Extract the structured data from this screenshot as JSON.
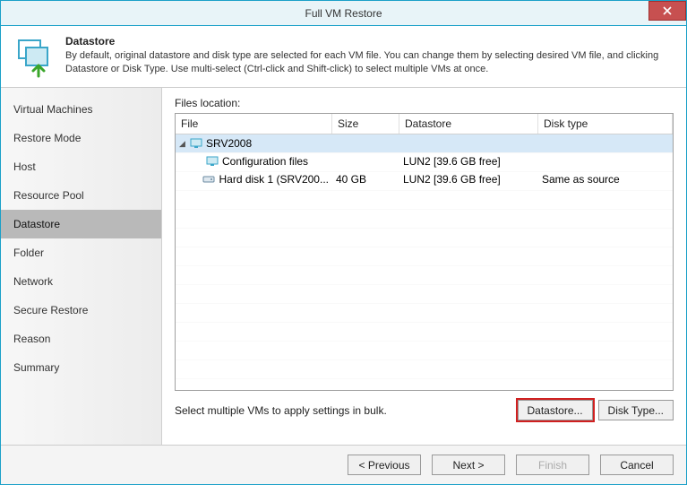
{
  "window": {
    "title": "Full VM Restore"
  },
  "header": {
    "heading": "Datastore",
    "desc": "By default, original datastore and disk type are selected for each VM file. You can change them by selecting desired VM file, and clicking Datastore or Disk Type. Use multi-select (Ctrl-click and Shift-click) to select multiple VMs at once."
  },
  "sidebar": {
    "items": [
      {
        "label": "Virtual Machines"
      },
      {
        "label": "Restore Mode"
      },
      {
        "label": "Host"
      },
      {
        "label": "Resource Pool"
      },
      {
        "label": "Datastore"
      },
      {
        "label": "Folder"
      },
      {
        "label": "Network"
      },
      {
        "label": "Secure Restore"
      },
      {
        "label": "Reason"
      },
      {
        "label": "Summary"
      }
    ],
    "selected_index": 4
  },
  "files_location": {
    "label": "Files location:",
    "columns": {
      "file": "File",
      "size": "Size",
      "datastore": "Datastore",
      "disk_type": "Disk type"
    },
    "rows": [
      {
        "indent": 0,
        "expandable": true,
        "expanded": true,
        "icon": "vm",
        "file": "SRV2008",
        "size": "",
        "datastore": "",
        "disk_type": "",
        "selected": true
      },
      {
        "indent": 1,
        "expandable": false,
        "icon": "config",
        "file": "Configuration files",
        "size": "",
        "datastore": "LUN2 [39.6 GB free]",
        "disk_type": ""
      },
      {
        "indent": 1,
        "expandable": false,
        "icon": "disk",
        "file": "Hard disk 1 (SRV200...",
        "size": "40 GB",
        "datastore": "LUN2 [39.6 GB free]",
        "disk_type": "Same as source"
      }
    ]
  },
  "bulk": {
    "hint": "Select multiple VMs to apply settings in bulk.",
    "datastore_btn": "Datastore...",
    "disktype_btn": "Disk Type..."
  },
  "footer": {
    "previous": "< Previous",
    "next": "Next >",
    "finish": "Finish",
    "cancel": "Cancel"
  }
}
